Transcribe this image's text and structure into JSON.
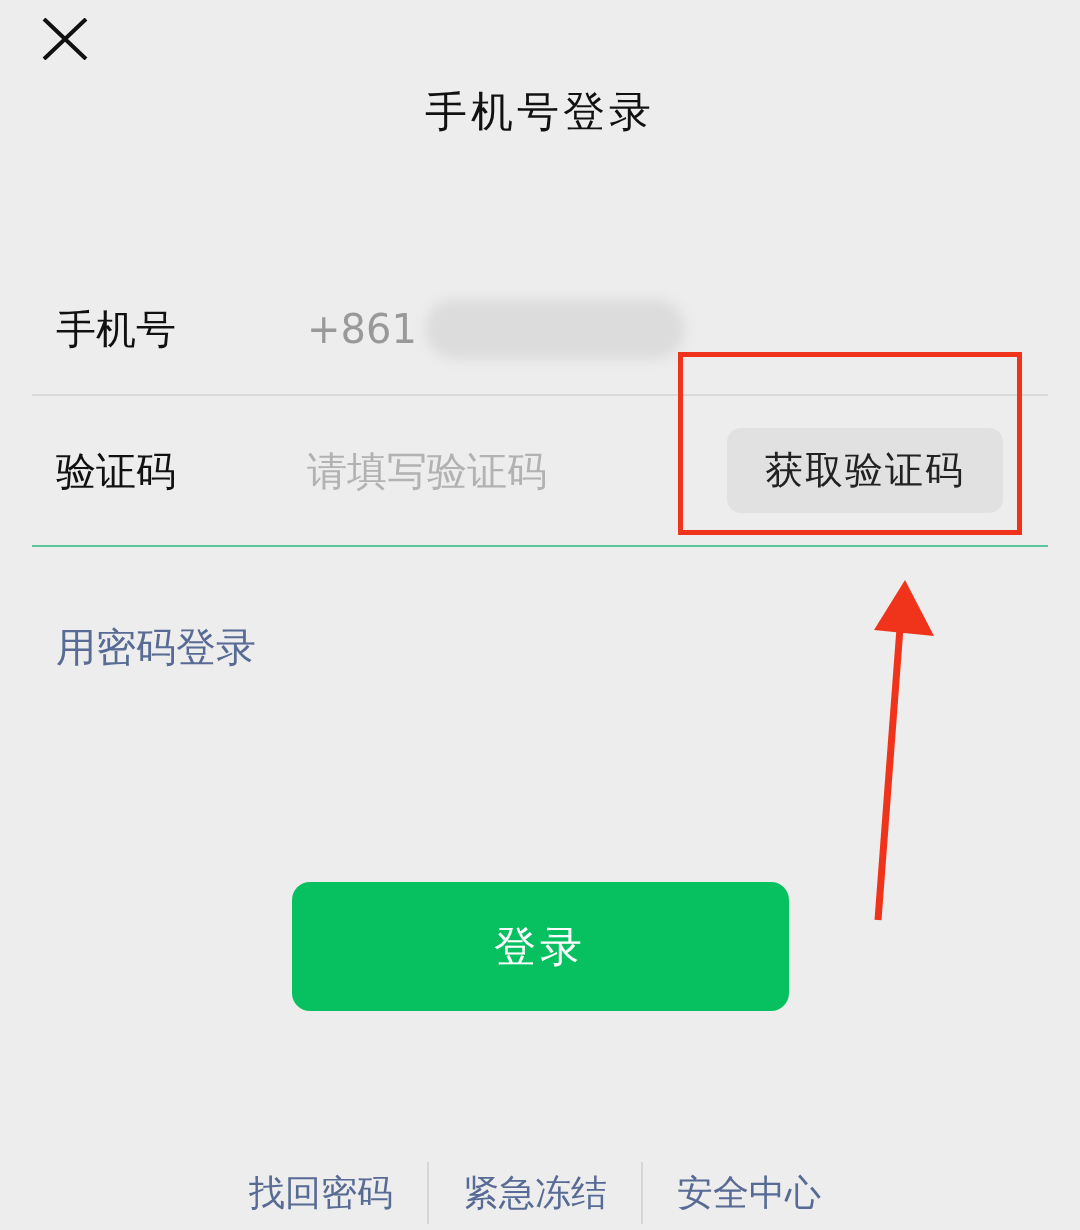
{
  "title": "手机号登录",
  "fields": [
    {
      "label": "手机号",
      "value": "+861",
      "blurred": true
    },
    {
      "label": "验证码",
      "placeholder": "请填写验证码",
      "button": "获取验证码",
      "focused": true
    }
  ],
  "password_login_link": "用密码登录",
  "login_button": "登录",
  "footer_links": [
    "找回密码",
    "紧急冻结",
    "安全中心"
  ],
  "annotations": {
    "box": true,
    "arrow": true
  }
}
